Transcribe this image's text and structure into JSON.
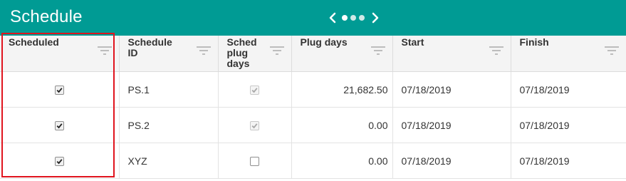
{
  "header": {
    "title": "Schedule",
    "bg_color": "#009b94"
  },
  "pager": {
    "prev_icon": "chevron-left-icon",
    "next_icon": "chevron-right-icon",
    "total_pages": 3,
    "active_page": 1
  },
  "columns": [
    {
      "label": "Scheduled"
    },
    {
      "label": "Schedule ID"
    },
    {
      "label": "Sched plug days"
    },
    {
      "label": "Plug days"
    },
    {
      "label": "Start"
    },
    {
      "label": "Finish"
    }
  ],
  "rows": [
    {
      "scheduled": true,
      "id": "PS.1",
      "sched_plug_days": true,
      "sched_plug_days_disabled": true,
      "plug_days": "21,682.50",
      "start": "07/18/2019",
      "finish": "07/18/2019"
    },
    {
      "scheduled": true,
      "id": "PS.2",
      "sched_plug_days": true,
      "sched_plug_days_disabled": true,
      "plug_days": "0.00",
      "start": "07/18/2019",
      "finish": "07/18/2019"
    },
    {
      "scheduled": true,
      "id": "XYZ",
      "sched_plug_days": false,
      "sched_plug_days_disabled": false,
      "plug_days": "0.00",
      "start": "07/18/2019",
      "finish": "07/18/2019"
    }
  ],
  "highlight_color": "#e0141e"
}
